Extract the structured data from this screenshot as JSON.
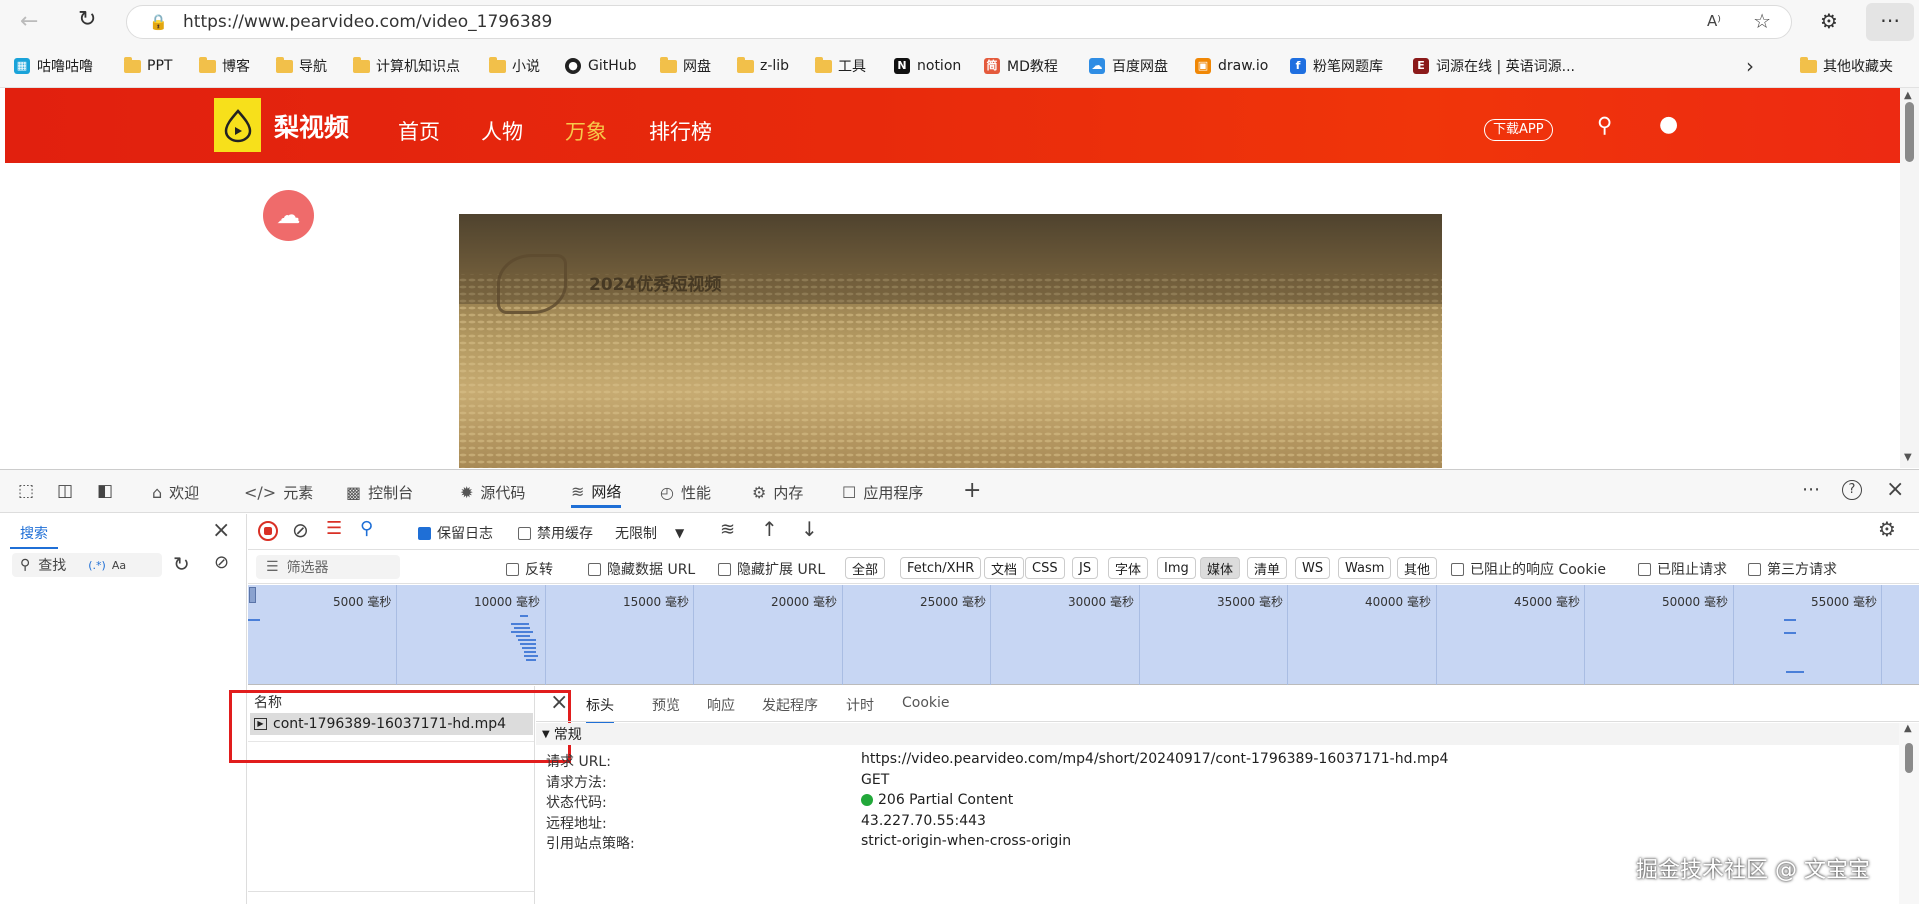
{
  "browser": {
    "url": "https://www.pearvideo.com/video_1796389",
    "bookmarks": [
      {
        "label": "咕噜咕噜",
        "icon": "bilibili-icon"
      },
      {
        "label": "PPT",
        "icon": "folder-icon"
      },
      {
        "label": "博客",
        "icon": "folder-icon"
      },
      {
        "label": "导航",
        "icon": "folder-icon"
      },
      {
        "label": "计算机知识点",
        "icon": "folder-icon"
      },
      {
        "label": "小说",
        "icon": "folder-icon"
      },
      {
        "label": "GitHub",
        "icon": "github-icon"
      },
      {
        "label": "网盘",
        "icon": "folder-icon"
      },
      {
        "label": "z-lib",
        "icon": "folder-icon"
      },
      {
        "label": "工具",
        "icon": "folder-icon"
      },
      {
        "label": "notion",
        "icon": "notion-icon"
      },
      {
        "label": "MD教程",
        "icon": "md-icon"
      },
      {
        "label": "百度网盘",
        "icon": "baidu-icon"
      },
      {
        "label": "draw.io",
        "icon": "drawio-icon"
      },
      {
        "label": "粉笔网题库",
        "icon": "fenbi-icon"
      },
      {
        "label": "词源在线 | 英语词源...",
        "icon": "etym-icon"
      }
    ],
    "other_bookmarks": "其他收藏夹"
  },
  "site": {
    "logo_text": "梨视频",
    "nav": [
      "首页",
      "人物",
      "万象",
      "排行榜"
    ],
    "download_app": "下载APP",
    "video_overlay_title": "2024优秀短视频"
  },
  "devtools": {
    "tabs": [
      "欢迎",
      "元素",
      "控制台",
      "源代码",
      "网络",
      "性能",
      "内存",
      "应用程序"
    ],
    "active_tab": "网络",
    "search_tab": "搜索",
    "search_placeholder": "查找",
    "toolbar": {
      "preserve_log": "保留日志",
      "disable_cache": "禁用缓存",
      "throttle": "无限制"
    },
    "filter": {
      "placeholder": "筛选器",
      "invert": "反转",
      "hide_data_url": "隐藏数据 URL",
      "hide_ext_url": "隐藏扩展 URL",
      "types": [
        "全部",
        "Fetch/XHR",
        "文档",
        "CSS",
        "JS",
        "字体",
        "Img",
        "媒体",
        "清单",
        "WS",
        "Wasm",
        "其他"
      ],
      "active_type": "媒体",
      "blocked_cookies": "已阻止的响应 Cookie",
      "blocked_requests": "已阻止请求",
      "third_party": "第三方请求"
    },
    "timeline_ticks": [
      "5000 毫秒",
      "10000 毫秒",
      "15000 毫秒",
      "20000 毫秒",
      "25000 毫秒",
      "30000 毫秒",
      "35000 毫秒",
      "40000 毫秒",
      "45000 毫秒",
      "50000 毫秒",
      "55000 毫秒"
    ],
    "name_header": "名称",
    "request_name": "cont-1796389-16037171-hd.mp4",
    "detail_tabs": [
      "标头",
      "预览",
      "响应",
      "发起程序",
      "计时",
      "Cookie"
    ],
    "general_section": "常规",
    "general": [
      {
        "label": "请求 URL:",
        "value": "https://video.pearvideo.com/mp4/short/20240917/cont-1796389-16037171-hd.mp4"
      },
      {
        "label": "请求方法:",
        "value": "GET"
      },
      {
        "label": "状态代码:",
        "value": "206 Partial Content"
      },
      {
        "label": "远程地址:",
        "value": "43.227.70.55:443"
      },
      {
        "label": "引用站点策略:",
        "value": "strict-origin-when-cross-origin"
      }
    ],
    "status_color": "#22a83a"
  },
  "watermark": "掘金技术社区 @ 文宝宝"
}
